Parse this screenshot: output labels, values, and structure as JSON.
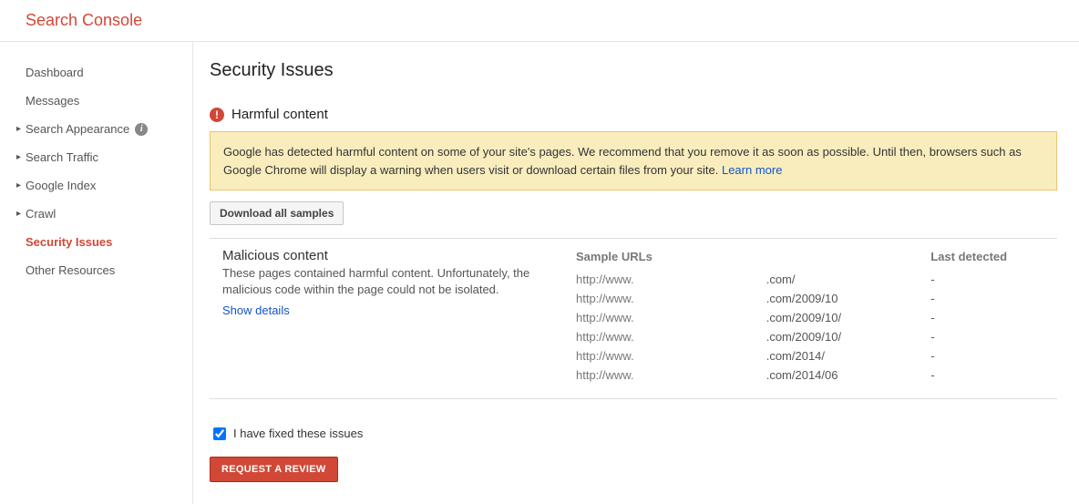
{
  "brand": "Search Console",
  "sidebar": {
    "items": [
      {
        "label": "Dashboard",
        "expandable": false
      },
      {
        "label": "Messages",
        "expandable": false
      },
      {
        "label": "Search Appearance",
        "expandable": true,
        "info": true
      },
      {
        "label": "Search Traffic",
        "expandable": true
      },
      {
        "label": "Google Index",
        "expandable": true
      },
      {
        "label": "Crawl",
        "expandable": true
      },
      {
        "label": "Security Issues",
        "expandable": false,
        "active": true
      },
      {
        "label": "Other Resources",
        "expandable": false
      }
    ]
  },
  "page": {
    "title": "Security Issues",
    "section_title": "Harmful content",
    "notice_text": "Google has detected harmful content on some of your site's pages. We recommend that you remove it as soon as possible. Until then, browsers such as Google Chrome will display a warning when users visit or download certain files from your site. ",
    "learn_more": "Learn more",
    "download_button": "Download all samples",
    "issue": {
      "title": "Malicious content",
      "desc": "These pages contained harmful content. Unfortunately, the malicious code within the page could not be isolated.",
      "show_details": "Show details"
    },
    "table": {
      "col_urls": "Sample URLs",
      "col_last": "Last detected",
      "rows": [
        {
          "scheme": "http://www.",
          "path": ".com/",
          "last": "-"
        },
        {
          "scheme": "http://www.",
          "path": ".com/2009/10",
          "last": "-"
        },
        {
          "scheme": "http://www.",
          "path": ".com/2009/10/",
          "last": "-"
        },
        {
          "scheme": "http://www.",
          "path": ".com/2009/10/",
          "last": "-"
        },
        {
          "scheme": "http://www.",
          "path": ".com/2014/",
          "last": "-"
        },
        {
          "scheme": "http://www.",
          "path": ".com/2014/06",
          "last": "-"
        }
      ]
    },
    "fixed_label": "I have fixed these issues",
    "fixed_checked": true,
    "request_button": "REQUEST A REVIEW"
  }
}
